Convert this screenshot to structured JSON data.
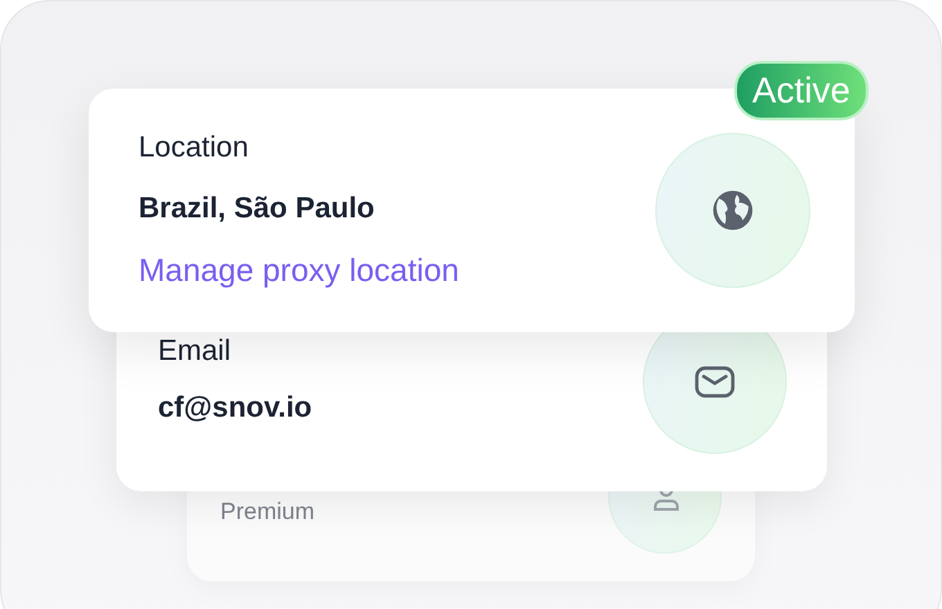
{
  "location_card": {
    "label": "Location",
    "value": "Brazil, São Paulo",
    "link": "Manage proxy location",
    "badge": "Active"
  },
  "email_card": {
    "label": "Email",
    "value": "cf@snov.io"
  },
  "plan_card": {
    "value": "Premium"
  }
}
